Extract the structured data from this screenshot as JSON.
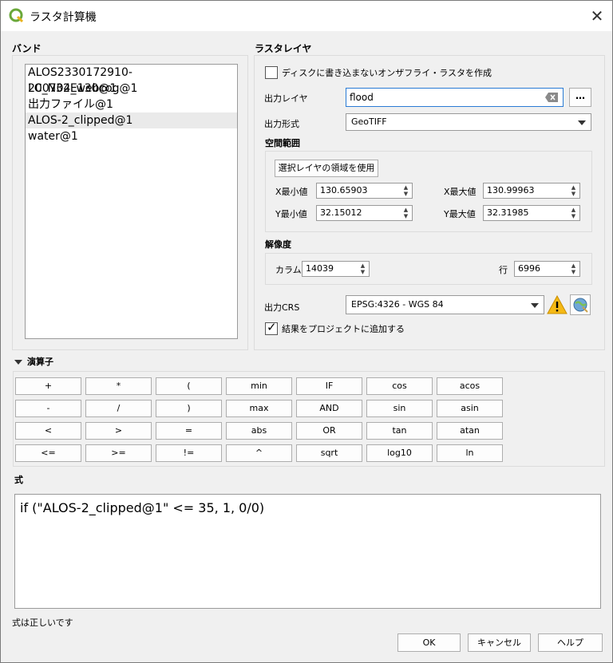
{
  "window": {
    "title": "ラスタ計算機",
    "close_icon": "close-icon",
    "app_icon": "qgis-icon"
  },
  "bands": {
    "header": "バンド",
    "items": [
      "ALOS2330172910-200704_webcog@1",
      "LC_N32E130@1",
      "出力ファイル@1",
      "ALOS-2_clipped@1",
      "water@1"
    ],
    "selected_index": 3
  },
  "raster_layer": {
    "header": "ラスタレイヤ",
    "on_the_fly_label": "ディスクに書き込まないオンザフライ・ラスタを作成",
    "on_the_fly_checked": false,
    "output_layer_label": "出力レイヤ",
    "output_layer_value": "flood",
    "browse_label": "…",
    "output_format_label": "出力形式",
    "output_format_value": "GeoTIFF",
    "extent_header": "空間範囲",
    "use_selected_extent_button": "選択レイヤの領域を使用",
    "xmin_label": "X最小値",
    "xmin_value": "130.65903",
    "xmax_label": "X最大値",
    "xmax_value": "130.99963",
    "ymin_label": "Y最小値",
    "ymin_value": "32.15012",
    "ymax_label": "Y最大値",
    "ymax_value": "32.31985",
    "resolution_header": "解像度",
    "columns_label": "カラム",
    "columns_value": "14039",
    "rows_label": "行",
    "rows_value": "6996",
    "output_crs_label": "出力CRS",
    "output_crs_value": "EPSG:4326 - WGS 84",
    "add_to_project_label": "結果をプロジェクトに追加する",
    "add_to_project_checked": true
  },
  "operators": {
    "header": "演算子",
    "buttons": [
      [
        "+",
        "*",
        "(",
        "min",
        "IF",
        "cos",
        "acos"
      ],
      [
        "-",
        "/",
        ")",
        "max",
        "AND",
        "sin",
        "asin"
      ],
      [
        "<",
        ">",
        "=",
        "abs",
        "OR",
        "tan",
        "atan"
      ],
      [
        "<=",
        ">=",
        "!=",
        "^",
        "sqrt",
        "log10",
        "ln"
      ]
    ]
  },
  "expression": {
    "header": "式",
    "value": "if (\"ALOS-2_clipped@1\" <= 35, 1, 0/0)",
    "status": "式は正しいです"
  },
  "footer": {
    "ok": "OK",
    "cancel": "キャンセル",
    "help": "ヘルプ"
  }
}
